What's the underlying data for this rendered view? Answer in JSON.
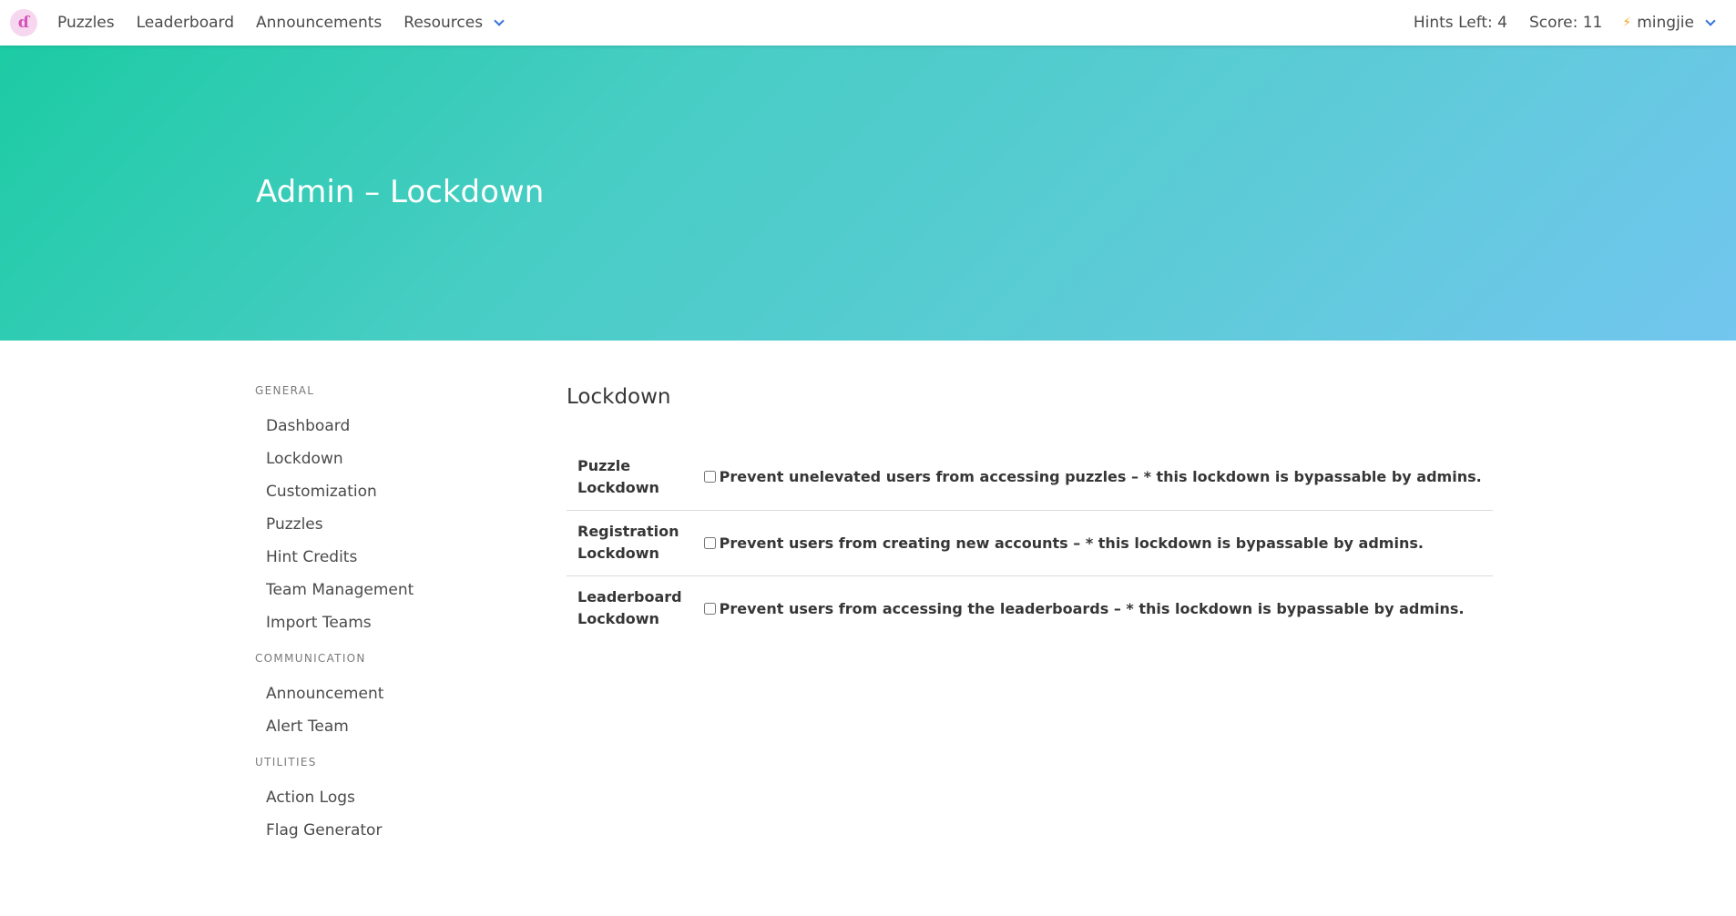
{
  "navbar": {
    "logo_glyph": "ɗ",
    "links": [
      {
        "label": "Puzzles"
      },
      {
        "label": "Leaderboard"
      },
      {
        "label": "Announcements"
      },
      {
        "label": "Resources"
      }
    ],
    "hints_left": "Hints Left: 4",
    "score": "Score: 11",
    "user_icon": "⚡",
    "username": "mingjie"
  },
  "hero": {
    "title": "Admin – Lockdown"
  },
  "sidebar": {
    "sections": [
      {
        "label": "General",
        "items": [
          "Dashboard",
          "Lockdown",
          "Customization",
          "Puzzles",
          "Hint Credits",
          "Team Management",
          "Import Teams"
        ]
      },
      {
        "label": "Communication",
        "items": [
          "Announcement",
          "Alert Team"
        ]
      },
      {
        "label": "Utilities",
        "items": [
          "Action Logs",
          "Flag Generator"
        ]
      }
    ]
  },
  "main": {
    "title": "Lockdown",
    "rows": [
      {
        "name": "Puzzle Lockdown",
        "description": "Prevent unelevated users from accessing puzzles – * this lockdown is bypassable by admins.",
        "checked": false
      },
      {
        "name": "Registration Lockdown",
        "description": "Prevent users from creating new accounts – * this lockdown is bypassable by admins.",
        "checked": false
      },
      {
        "name": "Leaderboard Lockdown",
        "description": "Prevent users from accessing the leaderboards – * this lockdown is bypassable by admins.",
        "checked": false
      }
    ]
  },
  "colors": {
    "accent": "#3273dc",
    "hero_start": "#1ccba4",
    "hero_end": "#72c6ef",
    "bolt": "#f5a623"
  }
}
